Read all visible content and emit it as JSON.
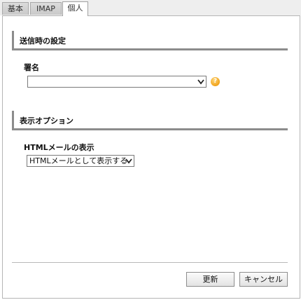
{
  "tabs": [
    {
      "label": "基本"
    },
    {
      "label": "IMAP"
    },
    {
      "label": "個人"
    }
  ],
  "sections": {
    "send": {
      "title": "送信時の設定",
      "signature_label": "署名",
      "signature_value": "",
      "help_glyph": "?"
    },
    "display": {
      "title": "表示オプション",
      "html_label": "HTMLメールの表示",
      "html_value": "HTMLメールとして表示する"
    }
  },
  "buttons": {
    "update": "更新",
    "cancel": "キャンセル"
  },
  "icons": {
    "help": "help-icon",
    "dropdown": "chevron-down-icon"
  },
  "colors": {
    "help_icon": "#f0a21a",
    "section_border": "#8c8c8c",
    "tab_active_bg": "#ffffff",
    "tab_inactive_bg": "#d3d3d3"
  }
}
